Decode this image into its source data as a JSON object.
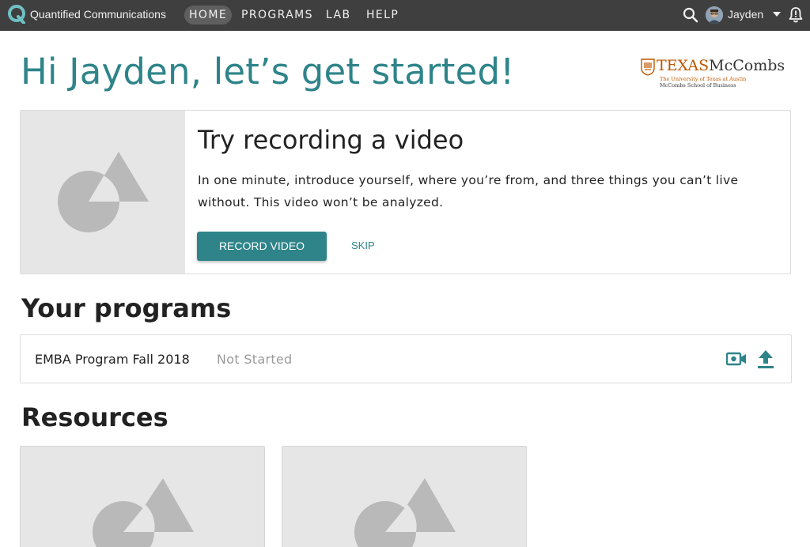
{
  "nav": {
    "brand": "Quantified Communications",
    "tabs": [
      {
        "label": "HOME",
        "active": true
      },
      {
        "label": "PROGRAMS",
        "active": false
      },
      {
        "label": "LAB",
        "active": false
      },
      {
        "label": "HELP",
        "active": false
      }
    ],
    "search_icon": "search-icon",
    "user": {
      "name": "Jayden"
    },
    "bell_icon": "bell-alert-icon"
  },
  "greeting": "Hi Jayden, let’s get started!",
  "logo": {
    "word_texas": "TEXAS",
    "word_mccombs": "McCombs",
    "line1": "The University of Texas at Austin",
    "line2": "McCombs School of Business"
  },
  "record_card": {
    "title": "Try recording a video",
    "description": "In one minute, introduce yourself, where you’re from, and three things you can’t live without. This video won’t be analyzed.",
    "record_button": "RECORD VIDEO",
    "skip_button": "SKIP"
  },
  "programs": {
    "heading": "Your programs",
    "items": [
      {
        "name": "EMBA Program Fall 2018",
        "status": "Not Started"
      }
    ]
  },
  "resources": {
    "heading": "Resources"
  },
  "colors": {
    "accent": "#2e8489",
    "nav_bg": "#3f3f3f",
    "placeholder_bg": "#e6e6e6",
    "placeholder_shape": "#b9b9b9",
    "logo_orange": "#bf5700"
  }
}
